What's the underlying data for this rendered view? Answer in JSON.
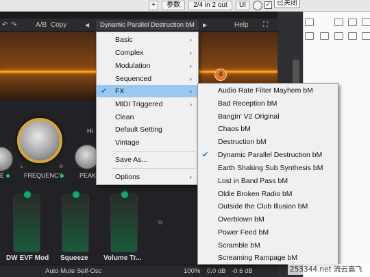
{
  "host": {
    "plus": "+",
    "params_label": "参数",
    "io_label": "2/4 in 2 out",
    "ui_label": "UI",
    "check_mark": "✓",
    "closed_label": "已关闭"
  },
  "plugin": {
    "toolbar": {
      "undo_icon": "↶",
      "redo_icon": "↷",
      "ab_label": "A/B",
      "copy_label": "Copy",
      "prev_arrow": "◀",
      "preset_name": "Dynamic Parallel Destruction bM",
      "next_arrow": "▶",
      "help_label": "Help",
      "fullscreen_icon": "⛶"
    },
    "node_label": "4",
    "knobs": {
      "frequency_label": "FREQUENCY",
      "peak_label": "PEAK",
      "left_fragment": "E",
      "hi_fragment": "Hi",
      "l_mark": "L",
      "r_mark": "R"
    },
    "faders": [
      {
        "label": "DW EVF Mod"
      },
      {
        "label": "Squeeze"
      },
      {
        "label": "Volume Tr..."
      }
    ],
    "more_icon": "»",
    "footer": {
      "auto_mute": "Auto Mute Self-Osc",
      "zoom": "100%",
      "db_in": "0.0 dB",
      "db_out": "-0.6 dB"
    }
  },
  "menu": {
    "items": [
      {
        "label": "Basic",
        "has_submenu": true,
        "checked": false
      },
      {
        "label": "Complex",
        "has_submenu": true,
        "checked": false
      },
      {
        "label": "Modulation",
        "has_submenu": true,
        "checked": false
      },
      {
        "label": "Sequenced",
        "has_submenu": true,
        "checked": false
      },
      {
        "label": "FX",
        "has_submenu": true,
        "checked": true,
        "active": true
      },
      {
        "label": "MIDI Triggered",
        "has_submenu": true,
        "checked": false
      },
      {
        "label": "Clean",
        "has_submenu": false,
        "checked": false
      },
      {
        "label": "Default Setting",
        "has_submenu": false,
        "checked": false
      },
      {
        "label": "Vintage",
        "has_submenu": false,
        "checked": false
      },
      {
        "label": "Save As...",
        "has_submenu": false,
        "checked": false
      },
      {
        "label": "Options",
        "has_submenu": true,
        "checked": false
      }
    ],
    "check_icon": "✔",
    "arrow_icon": "›"
  },
  "submenu": {
    "items": [
      {
        "label": "Audio Rate Filter Mayhem bM",
        "checked": false
      },
      {
        "label": "Bad Reception bM",
        "checked": false
      },
      {
        "label": "Bangin' V2 Original",
        "checked": false
      },
      {
        "label": "Chaos bM",
        "checked": false
      },
      {
        "label": "Destruction bM",
        "checked": false
      },
      {
        "label": "Dynamic Parallel Destruction bM",
        "checked": true
      },
      {
        "label": "Earth Shaking Sub Synthesis bM",
        "checked": false
      },
      {
        "label": "Lost in Band Pass bM",
        "checked": false
      },
      {
        "label": "Oldie Broken Radio bM",
        "checked": false
      },
      {
        "label": "Outside the Club Illusion bM",
        "checked": false
      },
      {
        "label": "Overblown bM",
        "checked": false
      },
      {
        "label": "Power Feed bM",
        "checked": false
      },
      {
        "label": "Scramble bM",
        "checked": false
      },
      {
        "label": "Screaming Rampage bM",
        "checked": false
      }
    ]
  },
  "watermark": "253344.net 流云高飞",
  "colors": {
    "accent_orange": "#ffa020",
    "menu_active": "#99c9f0",
    "check_blue": "#1e6bd6",
    "fader_green": "#1da06a"
  }
}
